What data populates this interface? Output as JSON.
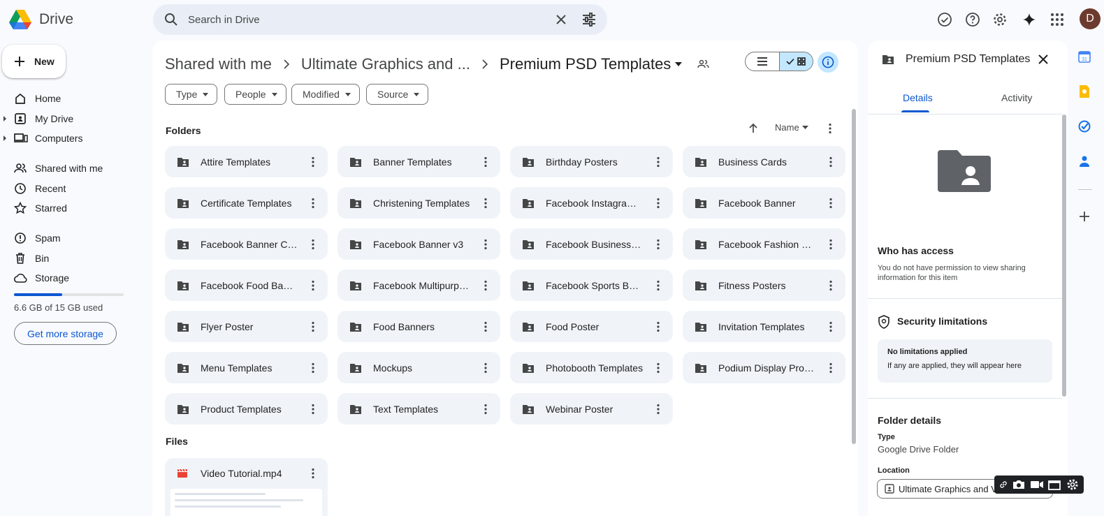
{
  "app": {
    "name": "Drive"
  },
  "search": {
    "placeholder": "Search in Drive"
  },
  "user": {
    "initial": "D",
    "avatar_color": "#6d3a2e"
  },
  "colors": {
    "accent": "#0b57d0",
    "selected_bg": "#c2e7ff",
    "folder_card_bg": "#f0f4f9"
  },
  "sidebar": {
    "new_label": "New",
    "items": [
      {
        "label": "Home",
        "icon": "home-icon"
      },
      {
        "label": "My Drive",
        "icon": "my-drive-icon"
      },
      {
        "label": "Computers",
        "icon": "computers-icon"
      },
      {
        "label": "Shared with me",
        "icon": "shared-icon"
      },
      {
        "label": "Recent",
        "icon": "clock-icon"
      },
      {
        "label": "Starred",
        "icon": "star-icon"
      },
      {
        "label": "Spam",
        "icon": "spam-icon"
      },
      {
        "label": "Bin",
        "icon": "trash-icon"
      },
      {
        "label": "Storage",
        "icon": "cloud-icon"
      }
    ],
    "storage_used_fraction": 0.44,
    "storage_text": "6.6 GB of 15 GB used",
    "get_storage_label": "Get more storage"
  },
  "breadcrumb": {
    "items": [
      "Shared with me",
      "Ultimate Graphics and ..."
    ],
    "current": "Premium PSD Templates"
  },
  "filters": [
    "Type",
    "People",
    "Modified",
    "Source"
  ],
  "folders_label": "Folders",
  "sort": {
    "label": "Name"
  },
  "folders": [
    "Attire Templates",
    "Banner Templates",
    "Birthday Posters",
    "Business Cards",
    "Certificate Templates",
    "Christening Templates",
    "Facebook Instagram ...",
    "Facebook Banner",
    "Facebook Banner Cov...",
    "Facebook Banner v3",
    "Facebook Business M...",
    "Facebook Fashion Ba...",
    "Facebook Food Banner",
    "Facebook Multipurpo...",
    "Facebook Sports Ban...",
    "Fitness Posters",
    "Flyer Poster",
    "Food Banners",
    "Food Poster",
    "Invitation Templates",
    "Menu Templates",
    "Mockups",
    "Photobooth Templates",
    "Podium Display Produ...",
    "Product Templates",
    "Text Templates",
    "Webinar Poster"
  ],
  "files_label": "Files",
  "files": [
    {
      "name": "Video Tutorial.mp4",
      "icon": "video-file-icon"
    }
  ],
  "details": {
    "title": "Premium PSD Templates",
    "tabs": [
      "Details",
      "Activity"
    ],
    "who_title": "Who has access",
    "who_desc": "You do not have permission to view sharing information for this item",
    "security_title": "Security limitations",
    "security_line1": "No limitations applied",
    "security_line2": "If any are applied, they will appear here",
    "folder_details_title": "Folder details",
    "type_label": "Type",
    "type_value": "Google Drive Folder",
    "location_label": "Location",
    "location_value": "Ultimate Graphics and V"
  }
}
